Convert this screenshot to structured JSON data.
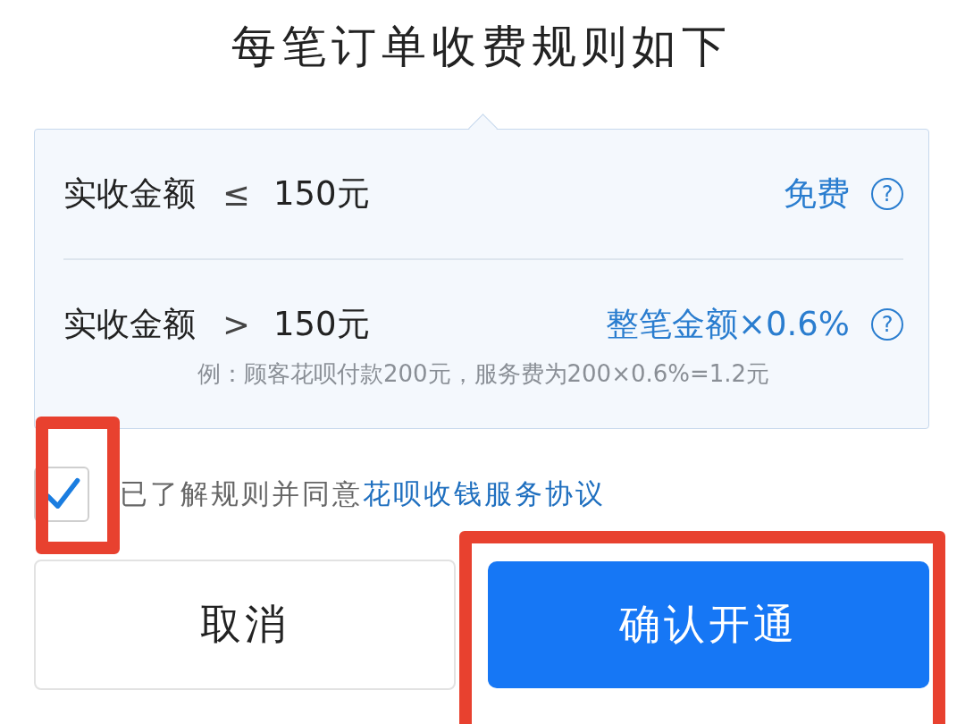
{
  "title": "每笔订单收费规则如下",
  "rules": [
    {
      "condition": "实收金额",
      "operator": "≤",
      "amount": "150元",
      "fee": "免费",
      "help_icon": "?"
    },
    {
      "condition": "实收金额",
      "operator": ">",
      "amount": "150元",
      "fee": "整笔金额×0.6%",
      "help_icon": "?"
    }
  ],
  "example": "例：顾客花呗付款200元，服务费为200×0.6%=1.2元",
  "agreement": {
    "checked": true,
    "text": "已了解规则并同意",
    "link": "花呗收钱服务协议"
  },
  "buttons": {
    "cancel": "取消",
    "confirm": "确认开通"
  }
}
